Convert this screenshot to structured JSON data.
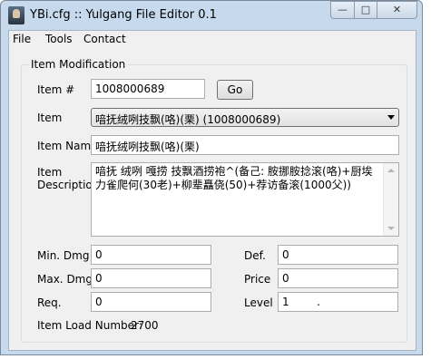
{
  "window": {
    "title": "YBi.cfg :: Yulgang File Editor 0.1",
    "min_glyph": "—",
    "max_glyph": "□",
    "close_glyph": "✕"
  },
  "menu": [
    "File",
    "Tools",
    "Contact"
  ],
  "group": {
    "legend": "Item Modification"
  },
  "form": {
    "item_no_label": "Item #",
    "item_no_value": "1008000689",
    "go_label": "Go",
    "item_label": "Item",
    "item_selected": "喑抚绒咧技飘(咯)(栗) (1008000689)",
    "item_name_label": "Item Name",
    "item_name_value": "喑抚绒咧技飘(咯)(栗)",
    "item_desc_label_1": "Item",
    "item_desc_label_2": "Description",
    "item_desc_value": "喑抚 绒咧 嘎捞 技飘酒捞袍^(备己: 胺挪胺捻滚(咯)+厨埃力雀爬何(30老)+柳辈矗侥(50)+荐访备滚(1000父))",
    "min_dmg_label": "Min. Dmg",
    "min_dmg_value": "0",
    "max_dmg_label": "Max. Dmg",
    "max_dmg_value": "0",
    "req_label": "Req.",
    "req_value": "0",
    "def_label": "Def.",
    "def_value": "0",
    "price_label": "Price",
    "price_value": "0",
    "level_label": "Level",
    "level_value": "1        .",
    "load_label": "Item Load Number:",
    "load_value": "2700"
  },
  "icons": {
    "app": "app-icon",
    "combo": "chevron-down-icon",
    "scroll_up": "scroll-up-icon",
    "scroll_down": "scroll-down-icon"
  },
  "colors": {
    "frame": "#c7d9ec",
    "client": "#f0f0f0"
  }
}
